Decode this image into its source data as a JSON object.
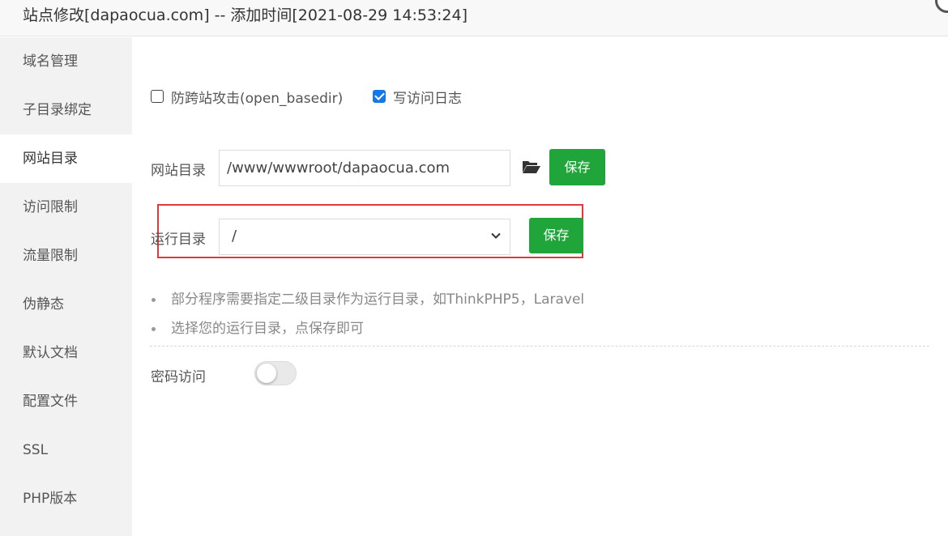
{
  "title": "站点修改[dapaocua.com] -- 添加时间[2021-08-29 14:53:24]",
  "sidebar": {
    "items": [
      {
        "label": "域名管理"
      },
      {
        "label": "子目录绑定"
      },
      {
        "label": "网站目录"
      },
      {
        "label": "访问限制"
      },
      {
        "label": "流量限制"
      },
      {
        "label": "伪静态"
      },
      {
        "label": "默认文档"
      },
      {
        "label": "配置文件"
      },
      {
        "label": "SSL"
      },
      {
        "label": "PHP版本"
      }
    ],
    "active_index": 2
  },
  "options": {
    "open_basedir": {
      "label": "防跨站攻击(open_basedir)",
      "checked": false
    },
    "access_log": {
      "label": "写访问日志",
      "checked": true
    }
  },
  "site_dir": {
    "label": "网站目录",
    "value": "/www/wwwroot/dapaocua.com",
    "folder_icon": "folder-open-icon",
    "save_label": "保存"
  },
  "run_dir": {
    "label": "运行目录",
    "selected": "/",
    "save_label": "保存"
  },
  "tips": [
    "部分程序需要指定二级目录作为运行目录，如ThinkPHP5，Laravel",
    "选择您的运行目录，点保存即可"
  ],
  "password_access": {
    "label": "密码访问",
    "enabled": false
  },
  "colors": {
    "save_button": "#20a53a",
    "checkbox_checked": "#1677e6",
    "highlight_border": "#e03a3a"
  }
}
